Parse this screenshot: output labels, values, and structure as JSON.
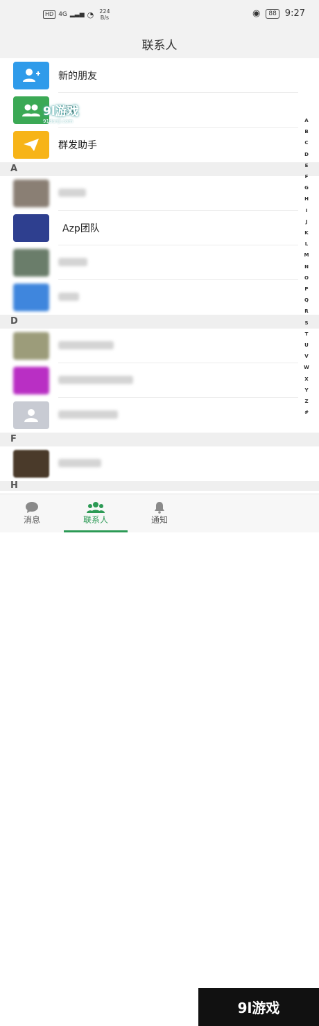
{
  "status_bar": {
    "hd": "HD",
    "network": "4G",
    "speed": "224",
    "speed_unit": "B/s",
    "battery": "88",
    "time": "9:27"
  },
  "header": {
    "title": "联系人"
  },
  "functions": [
    {
      "label": "新的朋友",
      "icon": "add-friend-icon",
      "color": "#2f9bea"
    },
    {
      "label": "群聊",
      "icon": "group-chat-icon",
      "color": "#3ba955"
    },
    {
      "label": "群发助手",
      "icon": "broadcast-icon",
      "color": "#f7b418"
    }
  ],
  "sections": [
    {
      "letter": "A",
      "contacts": [
        {
          "name": "",
          "avatar_color": "#8a7f74"
        },
        {
          "name": "Azp团队",
          "avatar_color": "#2e3f8f"
        },
        {
          "name": "",
          "avatar_color": "#6a7d6a"
        },
        {
          "name": "",
          "avatar_color": "#3f86dd"
        }
      ]
    },
    {
      "letter": "D",
      "contacts": [
        {
          "name": "",
          "avatar_color": "#9c9c7a"
        },
        {
          "name": "",
          "avatar_color": "#b92fc4"
        },
        {
          "name": "",
          "avatar_color": "#c8cbd3"
        }
      ]
    },
    {
      "letter": "F",
      "contacts": [
        {
          "name": "",
          "avatar_color": "#4a3a2a"
        }
      ]
    }
  ],
  "next_section_letter": "H",
  "index_letters": [
    "A",
    "B",
    "C",
    "D",
    "E",
    "F",
    "G",
    "H",
    "I",
    "J",
    "K",
    "L",
    "M",
    "N",
    "O",
    "P",
    "Q",
    "R",
    "S",
    "T",
    "U",
    "V",
    "W",
    "X",
    "Y",
    "Z",
    "#"
  ],
  "tabs": [
    {
      "label": "消息",
      "icon": "chat-bubble-icon"
    },
    {
      "label": "联系人",
      "icon": "contacts-icon"
    },
    {
      "label": "通知",
      "icon": "bell-icon"
    }
  ],
  "watermark": {
    "text": "9l游戏",
    "sub": "91danji.com"
  },
  "accent_color": "#2c9a55"
}
